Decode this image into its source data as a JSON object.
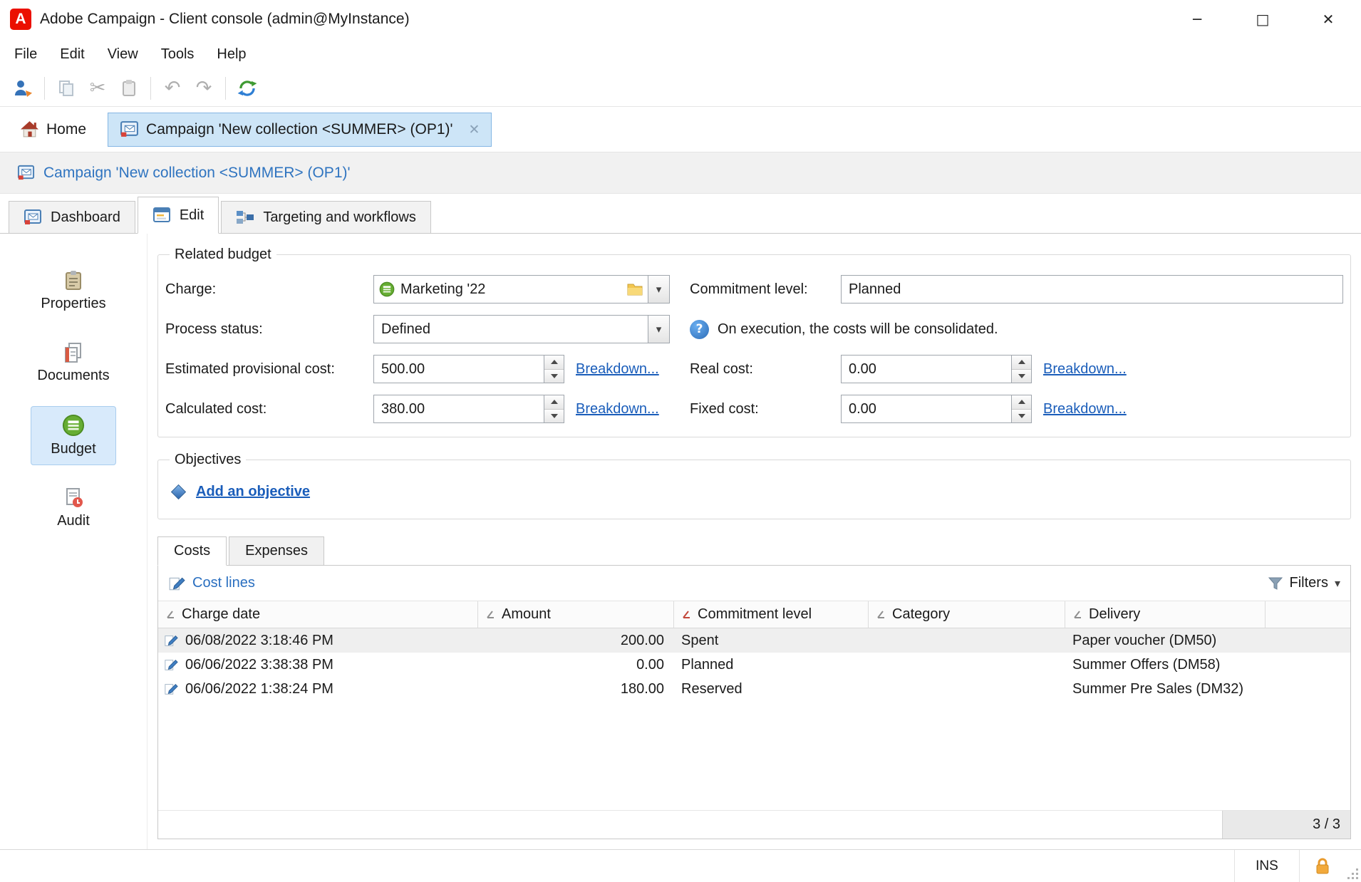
{
  "icons": {
    "minimize": "─",
    "maximize": "□",
    "close": "✕",
    "tab_close": "✕",
    "caret_down": "▾",
    "undo": "↶",
    "redo": "↷",
    "cut": "✂",
    "help": "?"
  },
  "colors": {
    "accent_blue": "#2a6fc0",
    "link_blue": "#1a5dba",
    "selection_blue": "#cde5f7",
    "adobe_red": "#eb1000",
    "budget_green": "#66ad33",
    "lock_orange": "#f2a93b"
  },
  "window": {
    "title": "Adobe Campaign - Client console (admin@MyInstance)"
  },
  "menu": {
    "items": [
      "File",
      "Edit",
      "View",
      "Tools",
      "Help"
    ]
  },
  "nav": {
    "home_label": "Home",
    "tab_label": "Campaign 'New collection <SUMMER> (OP1)'"
  },
  "breadcrumb": {
    "label": "Campaign 'New collection <SUMMER> (OP1)'"
  },
  "page_tabs": {
    "dashboard": "Dashboard",
    "edit": "Edit",
    "targeting": "Targeting and workflows"
  },
  "sidebar": {
    "properties": "Properties",
    "documents": "Documents",
    "budget": "Budget",
    "audit": "Audit"
  },
  "related_budget": {
    "title": "Related budget",
    "charge_label": "Charge:",
    "charge_value": "Marketing '22",
    "commitment_label": "Commitment level:",
    "commitment_value": "Planned",
    "process_label": "Process status:",
    "process_value": "Defined",
    "help_text": "On execution, the costs will be consolidated.",
    "estimated_label": "Estimated provisional cost:",
    "estimated_value": "500.00",
    "real_label": "Real cost:",
    "real_value": "0.00",
    "calculated_label": "Calculated cost:",
    "calculated_value": "380.00",
    "fixed_label": "Fixed cost:",
    "fixed_value": "0.00",
    "breakdown": "Breakdown..."
  },
  "objectives": {
    "title": "Objectives",
    "add_link": "Add an objective"
  },
  "costs": {
    "tab_costs": "Costs",
    "tab_expenses": "Expenses",
    "cost_lines_label": "Cost lines",
    "filters_label": "Filters",
    "columns": [
      "Charge date",
      "Amount",
      "Commitment level",
      "Category",
      "Delivery"
    ],
    "rows": [
      {
        "date": "06/08/2022 3:18:46 PM",
        "amount": "200.00",
        "level": "Spent",
        "category": "",
        "delivery": "Paper voucher (DM50)"
      },
      {
        "date": "06/06/2022 3:38:38 PM",
        "amount": "0.00",
        "level": "Planned",
        "category": "",
        "delivery": "Summer Offers (DM58)"
      },
      {
        "date": "06/06/2022 1:38:24 PM",
        "amount": "180.00",
        "level": "Reserved",
        "category": "",
        "delivery": "Summer Pre Sales (DM32)"
      }
    ],
    "count": "3 / 3"
  },
  "status": {
    "ins": "INS"
  }
}
